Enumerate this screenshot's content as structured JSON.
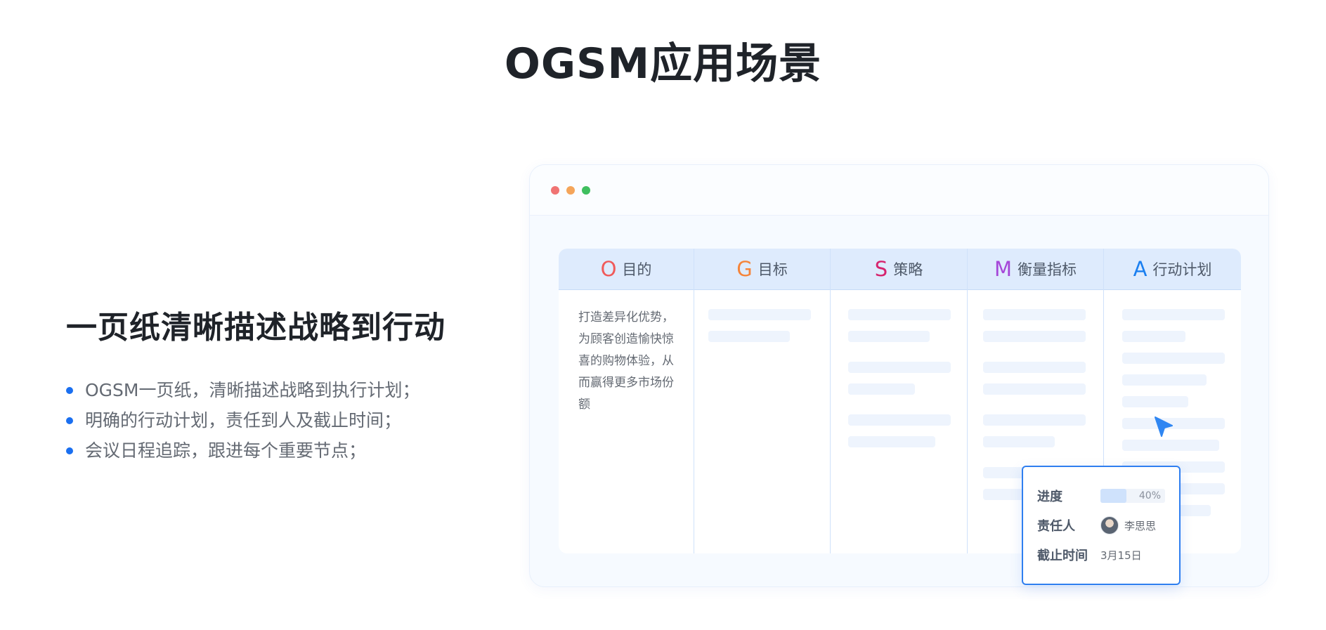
{
  "page": {
    "title": "OGSM应用场景"
  },
  "left": {
    "subtitle": "一页纸清晰描述战略到行动",
    "bullets": [
      "OGSM一页纸，清晰描述战略到执行计划；",
      "明确的行动计划，责任到人及截止时间；",
      "会议日程追踪，跟进每个重要节点；"
    ]
  },
  "table": {
    "columns": [
      {
        "letter": "O",
        "name": "目的",
        "color": "#f05a5a"
      },
      {
        "letter": "G",
        "name": "目标",
        "color": "#f5843a"
      },
      {
        "letter": "S",
        "name": "策略",
        "color": "#d6246e"
      },
      {
        "letter": "M",
        "name": "衡量指标",
        "color": "#a546d8"
      },
      {
        "letter": "A",
        "name": "行动计划",
        "color": "#1a7ff0"
      }
    ],
    "o_text": "打造差异化优势，为顾客创造愉快惊喜的购物体验，从而赢得更多市场份额"
  },
  "popup": {
    "progress": {
      "label": "进度",
      "value": 40,
      "display": "40%"
    },
    "owner": {
      "label": "责任人",
      "name": "李思思"
    },
    "deadline": {
      "label": "截止时间",
      "value": "3月15日"
    }
  },
  "colors": {
    "accent": "#1a6ff0",
    "header_bg": "#deebfd",
    "placeholder_bar": "#eef4fd"
  }
}
